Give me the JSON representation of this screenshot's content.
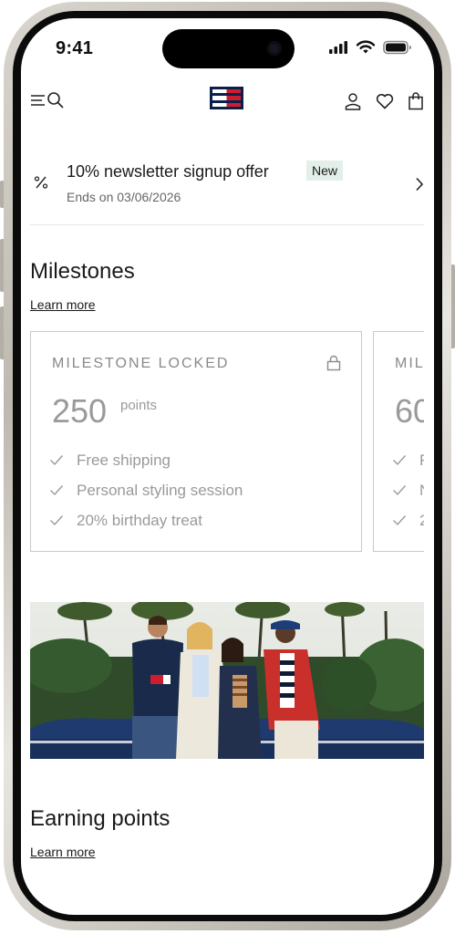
{
  "status_bar": {
    "time": "9:41"
  },
  "nav": {
    "menu_icon": "menu-icon",
    "search_icon": "search-icon",
    "logo_icon": "flag-logo",
    "account_icon": "account-icon",
    "wishlist_icon": "heart-icon",
    "bag_icon": "bag-icon"
  },
  "offer": {
    "icon": "percent-icon",
    "title": "10% newsletter signup offer",
    "badge": "New",
    "subtitle": "Ends on 03/06/2026"
  },
  "milestones": {
    "title": "Milestones",
    "learn_more": "Learn more",
    "cards": [
      {
        "label": "MILESTONE LOCKED",
        "points": "250",
        "unit": "points",
        "benefits": [
          "Free shipping",
          "Personal styling session",
          "20% birthday treat"
        ]
      },
      {
        "label": "MIL",
        "points": "60",
        "benefits": [
          "F",
          "N",
          "2"
        ]
      }
    ]
  },
  "earning": {
    "title": "Earning points",
    "learn_more": "Learn more"
  },
  "colors": {
    "brand_navy": "#0b1f4b",
    "brand_red": "#cc1e2f",
    "badge_bg": "#e3efe9",
    "muted_text": "#9a9a9a"
  }
}
